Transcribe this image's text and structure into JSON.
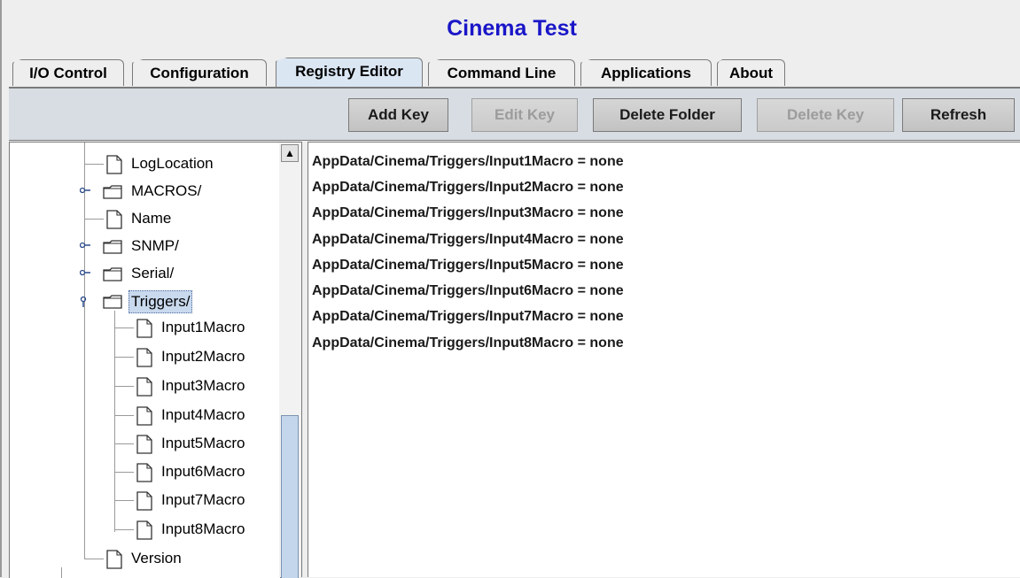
{
  "window": {
    "title": "Cinema Test"
  },
  "tabs": [
    {
      "label": "I/O Control",
      "active": false
    },
    {
      "label": "Configuration",
      "active": false
    },
    {
      "label": "Registry Editor",
      "active": true
    },
    {
      "label": "Command Line",
      "active": false
    },
    {
      "label": "Applications",
      "active": false
    },
    {
      "label": "About",
      "active": false
    }
  ],
  "toolbar": {
    "add_key": "Add Key",
    "edit_key": "Edit Key",
    "delete_folder": "Delete Folder",
    "delete_key": "Delete Key",
    "refresh": "Refresh"
  },
  "tree": {
    "items": [
      {
        "label": "LogLocation",
        "type": "file",
        "level": 1
      },
      {
        "label": "MACROS/",
        "type": "folder",
        "level": 1
      },
      {
        "label": "Name",
        "type": "file",
        "level": 1
      },
      {
        "label": "SNMP/",
        "type": "folder",
        "level": 1
      },
      {
        "label": "Serial/",
        "type": "folder",
        "level": 1
      },
      {
        "label": "Triggers/",
        "type": "folder",
        "level": 1,
        "expanded": true,
        "selected": true
      },
      {
        "label": "Input1Macro",
        "type": "file",
        "level": 2
      },
      {
        "label": "Input2Macro",
        "type": "file",
        "level": 2
      },
      {
        "label": "Input3Macro",
        "type": "file",
        "level": 2
      },
      {
        "label": "Input4Macro",
        "type": "file",
        "level": 2
      },
      {
        "label": "Input5Macro",
        "type": "file",
        "level": 2
      },
      {
        "label": "Input6Macro",
        "type": "file",
        "level": 2
      },
      {
        "label": "Input7Macro",
        "type": "file",
        "level": 2
      },
      {
        "label": "Input8Macro",
        "type": "file",
        "level": 2
      },
      {
        "label": "Version",
        "type": "file",
        "level": 1
      }
    ]
  },
  "content": {
    "lines": [
      "AppData/Cinema/Triggers/Input1Macro = none",
      "AppData/Cinema/Triggers/Input2Macro = none",
      "AppData/Cinema/Triggers/Input3Macro = none",
      "AppData/Cinema/Triggers/Input4Macro = none",
      "AppData/Cinema/Triggers/Input5Macro = none",
      "AppData/Cinema/Triggers/Input6Macro = none",
      "AppData/Cinema/Triggers/Input7Macro = none",
      "AppData/Cinema/Triggers/Input8Macro = none"
    ]
  },
  "colors": {
    "title": "#1a16c8",
    "active_tab": "#dbe6f3",
    "toolbar_bg": "#d8dde3",
    "selection": "#c9d9ee",
    "scroll_thumb": "#c4d6eb"
  }
}
